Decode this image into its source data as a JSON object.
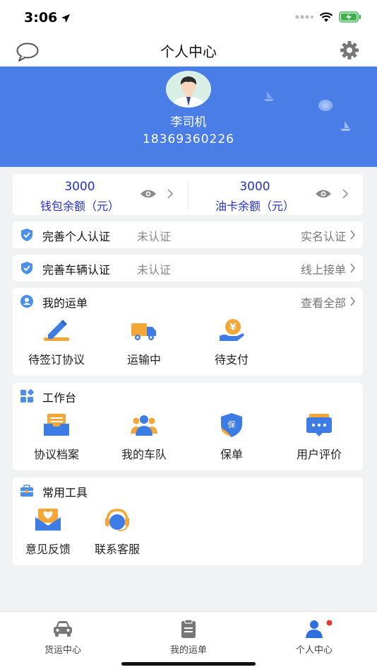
{
  "status_bar": {
    "time": "3:06"
  },
  "nav": {
    "title": "个人中心"
  },
  "profile": {
    "name": "李司机",
    "phone": "18369360226"
  },
  "balances": [
    {
      "amount": "3000",
      "label": "钱包余额（元）"
    },
    {
      "amount": "3000",
      "label": "油卡余额（元）"
    }
  ],
  "certifications": [
    {
      "title": "完善个人认证",
      "status": "未认证",
      "link": "实名认证"
    },
    {
      "title": "完善车辆认证",
      "status": "未认证",
      "link": "线上接单"
    }
  ],
  "waybills": {
    "title": "我的运单",
    "more": "查看全部",
    "items": [
      {
        "label": "待签订协议",
        "icon": "sign-pen-icon"
      },
      {
        "label": "运输中",
        "icon": "truck-icon"
      },
      {
        "label": "待支付",
        "icon": "payment-icon"
      }
    ]
  },
  "workbench": {
    "title": "工作台",
    "items": [
      {
        "label": "协议档案",
        "icon": "archive-icon"
      },
      {
        "label": "我的车队",
        "icon": "fleet-icon"
      },
      {
        "label": "保单",
        "icon": "insurance-icon",
        "badge": "保"
      },
      {
        "label": "用户评价",
        "icon": "review-icon"
      }
    ]
  },
  "tools": {
    "title": "常用工具",
    "items": [
      {
        "label": "意见反馈",
        "icon": "feedback-icon"
      },
      {
        "label": "联系客服",
        "icon": "customer-service-icon"
      }
    ]
  },
  "tabs": [
    {
      "label": "货运中心",
      "icon": "car-icon"
    },
    {
      "label": "我的运单",
      "icon": "clipboard-icon"
    },
    {
      "label": "个人中心",
      "icon": "person-icon",
      "active": true
    }
  ],
  "colors": {
    "primary": "#4a7ee6",
    "amount": "#2430c8",
    "orange": "#f4a637",
    "badge": "#e53935"
  }
}
